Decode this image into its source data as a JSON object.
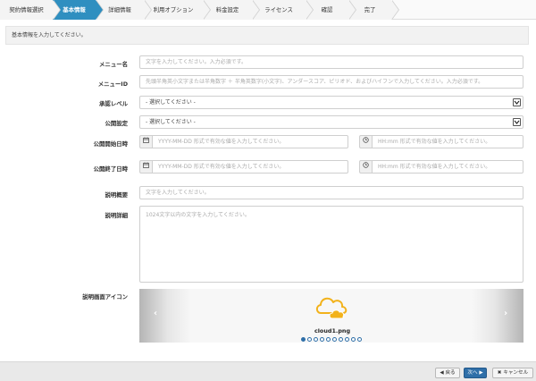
{
  "steps": [
    {
      "label": "契約情報選択",
      "active": false
    },
    {
      "label": "基本情報",
      "active": true
    },
    {
      "label": "詳細情報",
      "active": false
    },
    {
      "label": "利用オプション",
      "active": false
    },
    {
      "label": "料金設定",
      "active": false
    },
    {
      "label": "ライセンス",
      "active": false
    },
    {
      "label": "確認",
      "active": false
    },
    {
      "label": "完了",
      "active": false
    }
  ],
  "intro": "基本情報を入力してください。",
  "form": {
    "menu_name": {
      "label": "メニュー名",
      "placeholder": "文字を入力してください。入力必須です。"
    },
    "menu_id": {
      "label": "メニューID",
      "placeholder": "先頭半角英小文字または半角数字 ＋ 半角英数字(小文字)、アンダースコア、ピリオド、およびハイフンで入力してください。入力必須です。"
    },
    "approval_level": {
      "label": "承認レベル",
      "value": "- 選択してください -"
    },
    "publish_setting": {
      "label": "公開設定",
      "value": "- 選択してください -"
    },
    "publish_start": {
      "label": "公開開始日時",
      "date_placeholder": "YYYY-MM-DD 形式で有効な値を入力してください。",
      "time_placeholder": "HH:mm 形式で有効な値を入力してください。"
    },
    "publish_end": {
      "label": "公開終了日時",
      "date_placeholder": "YYYY-MM-DD 形式で有効な値を入力してください。",
      "time_placeholder": "HH:mm 形式で有効な値を入力してください。"
    },
    "desc_summary": {
      "label": "説明概要",
      "placeholder": "文字を入力してください。"
    },
    "desc_detail": {
      "label": "説明詳細",
      "placeholder": "1024文字以内の文字を入力してください。"
    },
    "desc_icon": {
      "label": "説明画面アイコン",
      "filename": "cloud1.png",
      "dots_total": 10,
      "dots_active": 0
    }
  },
  "icons": {
    "calendar": "calendar-icon",
    "clock": "clock-icon",
    "chevron": "chevron-down-icon",
    "cloud": "cloud-icon"
  },
  "colors": {
    "step_active": "#2f8fc0",
    "primary_button": "#2f6fa8",
    "cloud": "#f2b21b"
  },
  "footer": {
    "back": "戻る",
    "next": "次へ",
    "cancel": "キャンセル"
  }
}
